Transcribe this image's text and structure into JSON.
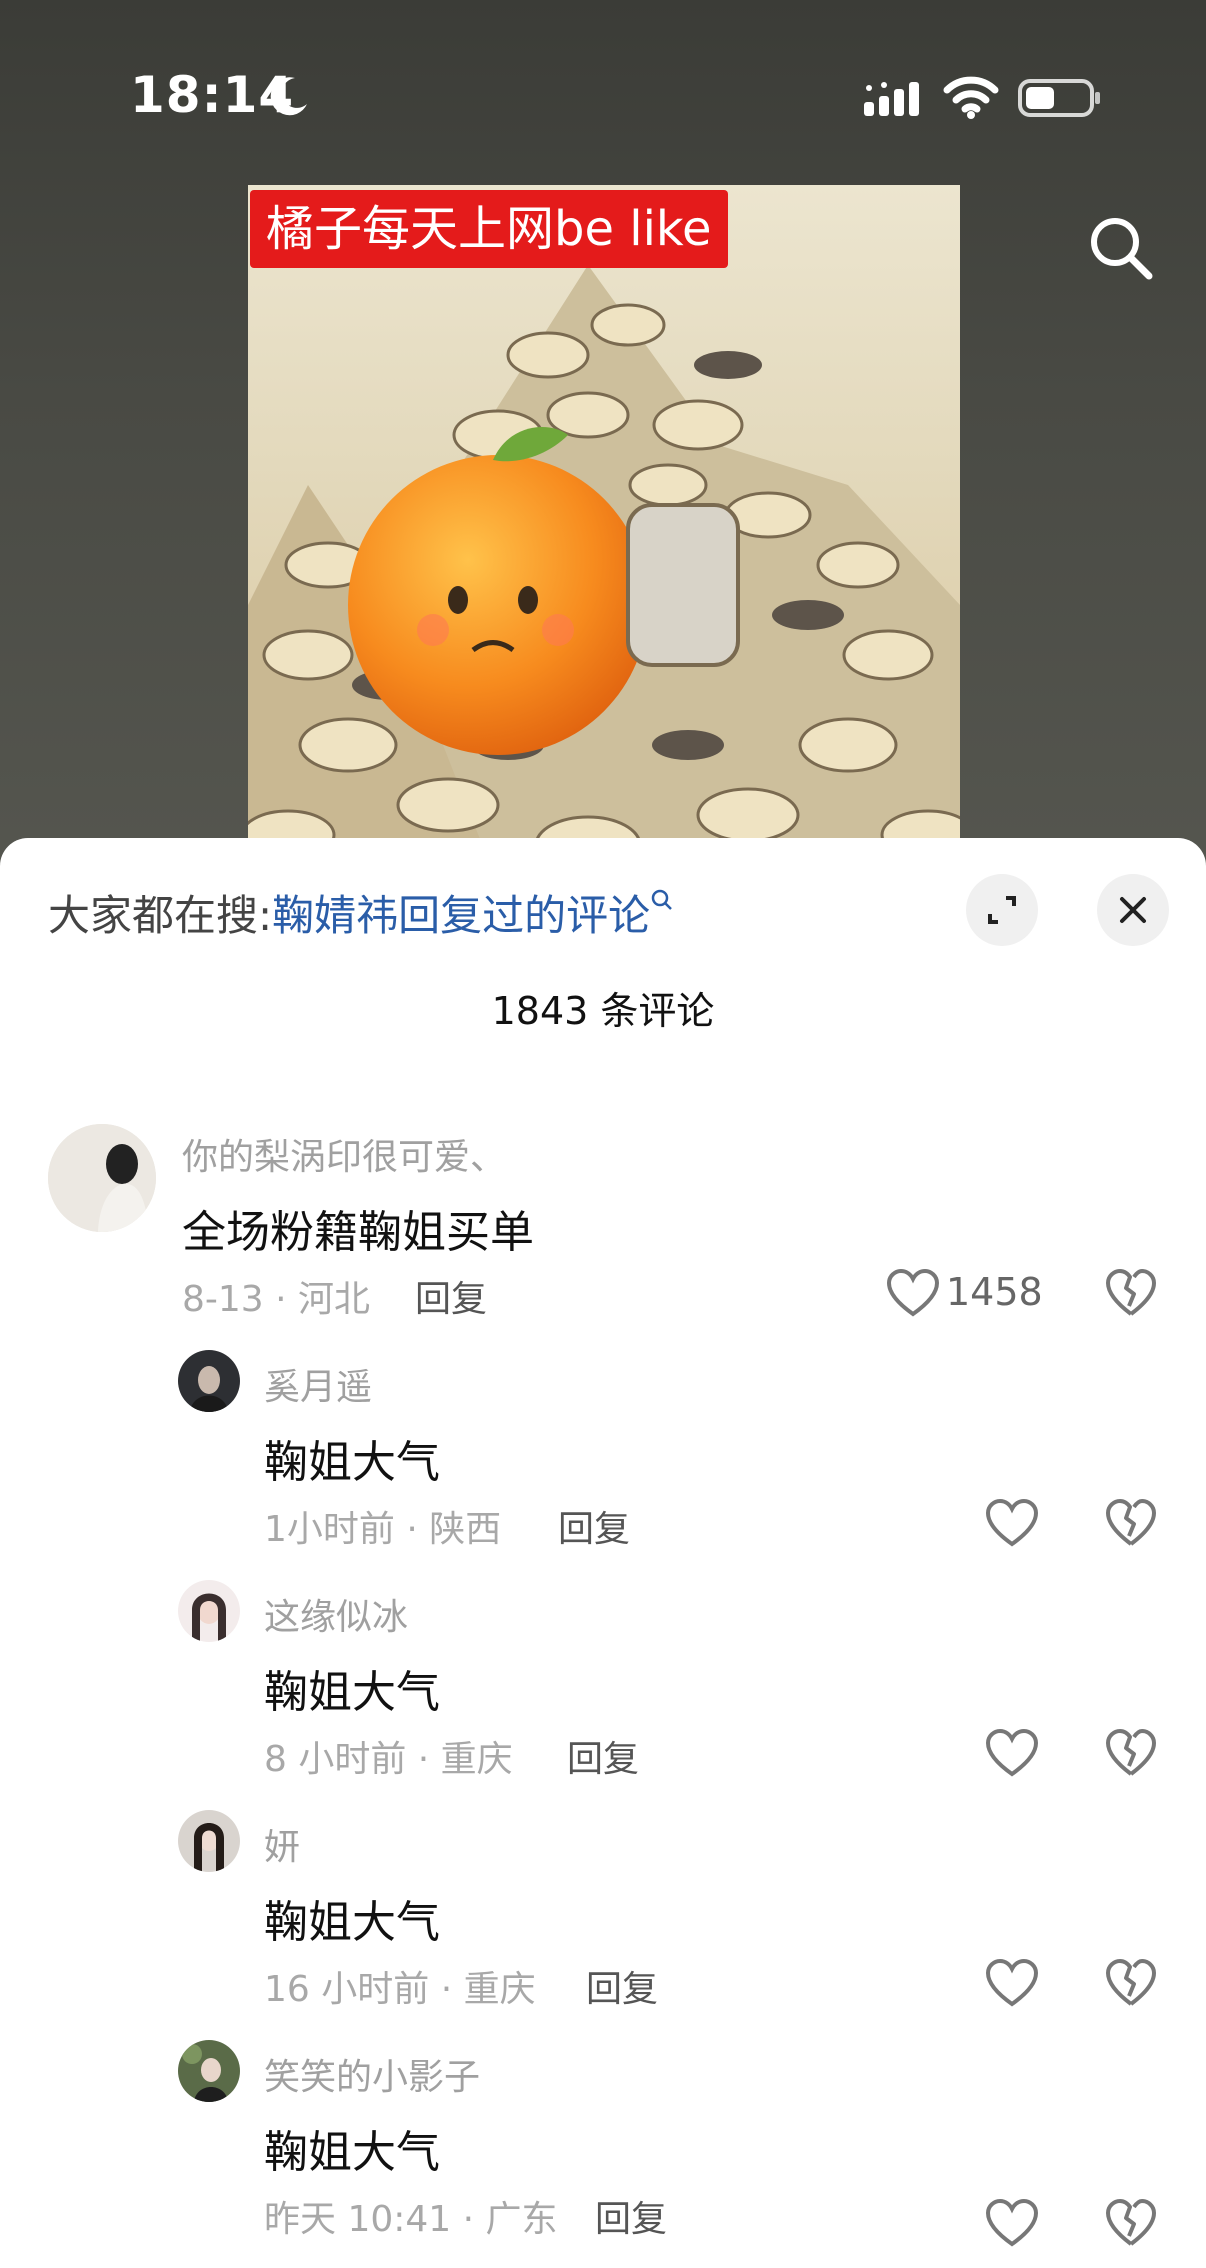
{
  "status_bar": {
    "time": "18:14"
  },
  "post": {
    "image_caption": "橘子每天上网be like"
  },
  "comments_panel": {
    "search_prefix": "大家都在搜:",
    "search_link": "鞠婧祎回复过的评论",
    "count_label": "1843 条评论"
  },
  "comment": {
    "username": "你的梨涡印很可爱、",
    "text": "全场粉籍鞠姐买单",
    "meta": "8-13 · 河北",
    "reply_label": "回复",
    "likes": "1458"
  },
  "replies": [
    {
      "username": "奚月遥",
      "text": "鞠姐大气",
      "meta": "1小时前 · 陕西",
      "reply_label": "回复"
    },
    {
      "username": "这缘似冰",
      "text": "鞠姐大气",
      "meta": "8 小时前 · 重庆",
      "reply_label": "回复"
    },
    {
      "username": "妍",
      "text": "鞠姐大气",
      "meta": "16 小时前 · 重庆",
      "reply_label": "回复"
    },
    {
      "username": "笑笑的小影子",
      "text": "鞠姐大气",
      "meta": "昨天 10:41 · 广东",
      "reply_label": "回复"
    }
  ],
  "colors": {
    "caption_bg": "#e41b1b",
    "link": "#2a5da8"
  }
}
